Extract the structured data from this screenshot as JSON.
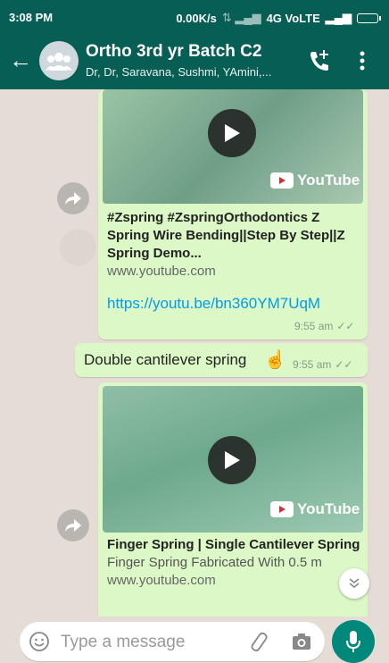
{
  "status_bar": {
    "time": "3:08 PM",
    "network_speed": "0.00K/s",
    "network_label": "4G VoLTE"
  },
  "header": {
    "title": "Ortho 3rd yr Batch C2",
    "participants": "Dr, Dr, Saravana, Sushmi, YAmini,..."
  },
  "messages": [
    {
      "type": "link_preview",
      "preview_title": "#Zspring #ZspringOrthodontics Z Spring Wire Bending||Step By Step||Z Spring Demo...",
      "preview_domain": "www.youtube.com",
      "link": "https://youtu.be/bn360YM7UqM",
      "time": "9:55 am",
      "youtube_label": "YouTube"
    },
    {
      "type": "text",
      "text": "Double cantilever spring",
      "emoji": "☝️",
      "time": "9:55 am"
    },
    {
      "type": "link_preview",
      "preview_title": "Finger Spring | Single Cantilever Spring",
      "preview_desc": "Finger Spring Fabricated With 0.5 m",
      "preview_domain": "www.youtube.com",
      "youtube_label": "YouTube"
    }
  ],
  "input": {
    "placeholder": "Type a message"
  },
  "colors": {
    "header": "#075e54",
    "bubble_out": "#dcf8c6",
    "link": "#039be5",
    "mic": "#00897b"
  },
  "icons": [
    "back-arrow-icon",
    "group-avatar-icon",
    "add-call-icon",
    "more-vert-icon",
    "forward-icon",
    "play-icon",
    "youtube-logo-icon",
    "double-check-icon",
    "chevron-double-down-icon",
    "emoji-icon",
    "paperclip-icon",
    "camera-icon",
    "mic-icon"
  ]
}
